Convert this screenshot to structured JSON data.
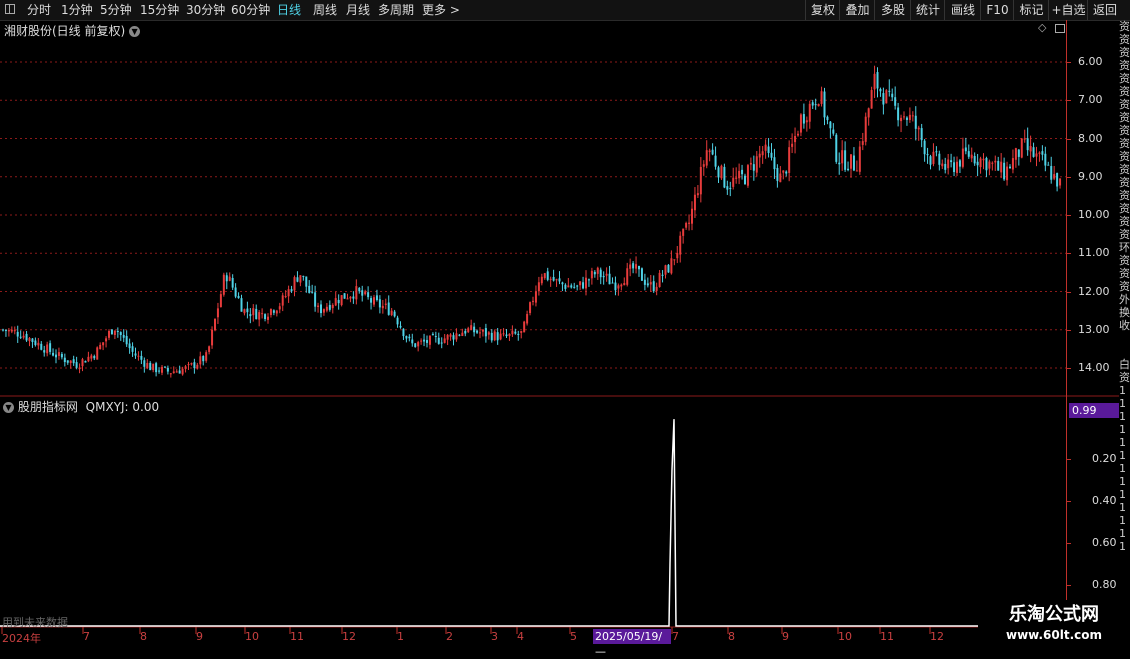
{
  "toolbar": {
    "periods": [
      "分时",
      "1分钟",
      "5分钟",
      "15分钟",
      "30分钟",
      "60分钟",
      "日线",
      "周线",
      "月线",
      "多周期",
      "更多 >"
    ],
    "active_period": "日线",
    "right_buttons": [
      "复权",
      "叠加",
      "多股",
      "统计",
      "画线",
      "F10",
      "标记",
      "+自选",
      "返回"
    ]
  },
  "main_panel": {
    "title": "湘财股份(日线 前复权)",
    "y_ticks": [
      "14.00",
      "13.00",
      "12.00",
      "11.00",
      "10.00",
      "9.00",
      "8.00",
      "7.00",
      "6.00"
    ]
  },
  "indicator_panel": {
    "title": "股朋指标网",
    "formula": "QMXYJ: 0.00",
    "value_badge": "0.99",
    "y_ticks": [
      "0.80",
      "0.60",
      "0.40",
      "0.20"
    ],
    "note": "用到未来数据"
  },
  "x_axis": {
    "labels": [
      "2024年",
      "7",
      "8",
      "9",
      "10",
      "11",
      "12",
      "1",
      "2",
      "3",
      "4",
      "5",
      "7",
      "8",
      "9",
      "10",
      "11",
      "12"
    ],
    "cursor_date": "2025/05/19/—"
  },
  "side_strip_chars": [
    "资",
    "资",
    "资",
    "资",
    "资",
    "资",
    "资",
    "资",
    "资",
    "资",
    "资",
    "资",
    "资",
    "资",
    "资",
    "资",
    "资",
    "环",
    "资",
    "资",
    "资",
    "外",
    "换",
    "收",
    "",
    "",
    "白",
    "资",
    "1",
    "1",
    "1",
    "1",
    "1",
    "1",
    "1",
    "1",
    "1",
    "1",
    "1",
    "1",
    "1"
  ],
  "watermark": {
    "name": "乐淘公式网",
    "url": "www.60lt.com"
  },
  "colors": {
    "up": "#e83c3c",
    "down": "#4fd2e6",
    "grid": "#8c1a1a",
    "axis": "#c0302a",
    "badge": "#5a1a9a",
    "active": "#4fd2e6"
  },
  "chart_data": [
    {
      "type": "candlestick",
      "title": "湘财股份(日线 前复权)",
      "ylim": [
        5.6,
        14.6
      ],
      "y_ticks": [
        6,
        7,
        8,
        9,
        10,
        11,
        12,
        13,
        14
      ],
      "x_labels": [
        "2024年",
        "7",
        "8",
        "9",
        "10",
        "11",
        "12",
        "1",
        "2",
        "3",
        "4",
        "5",
        "7",
        "8",
        "9",
        "10",
        "11",
        "12"
      ],
      "approx_close_path": [
        7.0,
        6.9,
        6.6,
        6.3,
        6.1,
        6.4,
        7.1,
        6.4,
        6.0,
        5.9,
        6.0,
        6.3,
        8.5,
        7.5,
        7.4,
        7.7,
        8.5,
        7.5,
        7.8,
        8.0,
        7.7,
        7.5,
        6.6,
        6.7,
        6.8,
        7.0,
        6.9,
        6.8,
        6.9,
        8.5,
        8.2,
        8.1,
        8.5,
        8.2,
        8.6,
        8.1,
        8.7,
        9.8,
        11.8,
        10.8,
        11.0,
        11.7,
        10.9,
        12.5,
        13.2,
        11.5,
        11.3,
        13.5,
        12.8,
        12.5,
        11.5,
        11.2,
        11.6,
        11.4,
        11.1,
        11.8,
        11.4,
        10.8
      ]
    },
    {
      "type": "line",
      "title": "股朋指标网",
      "series": [
        {
          "name": "QMXYJ",
          "values": [
            0.0,
            0.0,
            0.99,
            0.0,
            0.0
          ]
        }
      ],
      "ylim": [
        0,
        1.0
      ],
      "y_ticks": [
        0.2,
        0.4,
        0.6,
        0.8
      ],
      "spike_at": "2025/05/19"
    }
  ]
}
